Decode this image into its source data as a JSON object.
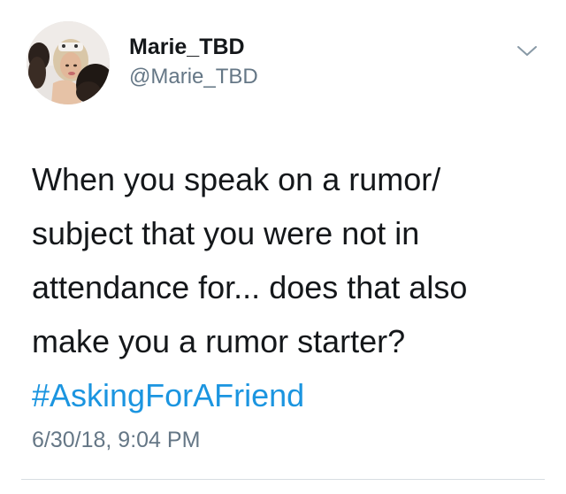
{
  "tweet": {
    "author": {
      "display_name": "Marie_TBD",
      "handle": "@Marie_TBD",
      "avatar_icon": "profile-photo"
    },
    "menu_icon": "chevron-down-icon",
    "text_lines": [
      "When you speak on a rumor/",
      "subject that you were not in",
      "attendance for... does that also",
      "make you a rumor starter?"
    ],
    "hashtag": "#AskingForAFriend",
    "timestamp": "6/30/18, 9:04 PM"
  },
  "colors": {
    "text": "#14171a",
    "secondary": "#657786",
    "link": "#1b95e0",
    "divider": "#d8dde2"
  }
}
